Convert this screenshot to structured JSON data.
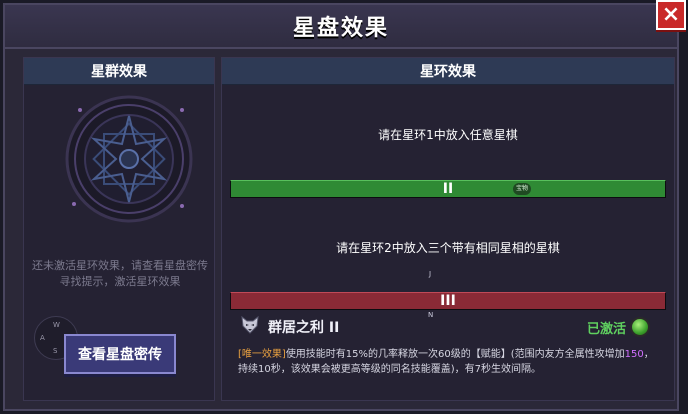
{
  "window": {
    "title": "星盘效果",
    "close_label": "×"
  },
  "left_panel": {
    "header": "星群效果",
    "hint": "还未激活星环效果，请查看星盘密传寻找提示，激活星环效果",
    "joystick": {
      "w": "W",
      "a": "A",
      "s": "S",
      "d": "D"
    },
    "button_label": "查看星盘密传"
  },
  "right_panel": {
    "header": "星环效果",
    "slot1_text": "请在星环1中放入任意星棋",
    "ring2_label": "II",
    "ring2_badge": "宝物",
    "slot2_text": "请在星环2中放入三个带有相同星相的星棋",
    "marker_j": "J",
    "ring3_label": "III",
    "marker_n": "N",
    "effect": {
      "name": "群居之利 II",
      "status": "已激活",
      "tag": "[唯一效果]",
      "desc_a": "使用技能时有15%的几率释放一次60级的【赋能】(范围内友方全属性攻增加",
      "highlight": "150",
      "desc_b": "，持续10秒，该效果会被更高等级的同名技能覆盖)，有7秒生效间隔。"
    }
  },
  "colors": {
    "ring2": "#2f8a34",
    "ring3": "#8a2a36",
    "active": "#5fd05f",
    "tag": "#e8a040",
    "highlight": "#d070ff"
  }
}
